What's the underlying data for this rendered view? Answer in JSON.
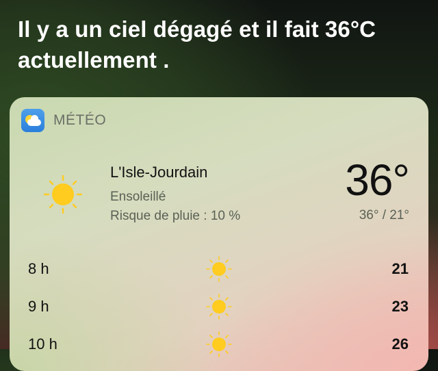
{
  "siri": {
    "response": "Il y a un ciel dégagé et il fait 36°C actuellement ."
  },
  "widget": {
    "app_name": "MÉTÉO",
    "icon": "weather-app-icon",
    "location": "L'Isle-Jourdain",
    "condition": "Ensoleillé",
    "rain_chance": "Risque de pluie : 10 %",
    "current_temp": "36°",
    "range": "36° / 21°",
    "condition_icon": "sun-icon",
    "hourly": [
      {
        "hour": "8 h",
        "icon": "sun-icon",
        "temp": "21"
      },
      {
        "hour": "9 h",
        "icon": "sun-icon",
        "temp": "23"
      },
      {
        "hour": "10 h",
        "icon": "sun-icon",
        "temp": "26"
      }
    ]
  },
  "colors": {
    "sun": "#ffcc1f",
    "text_primary": "#111111",
    "text_secondary": "#5a6155"
  }
}
